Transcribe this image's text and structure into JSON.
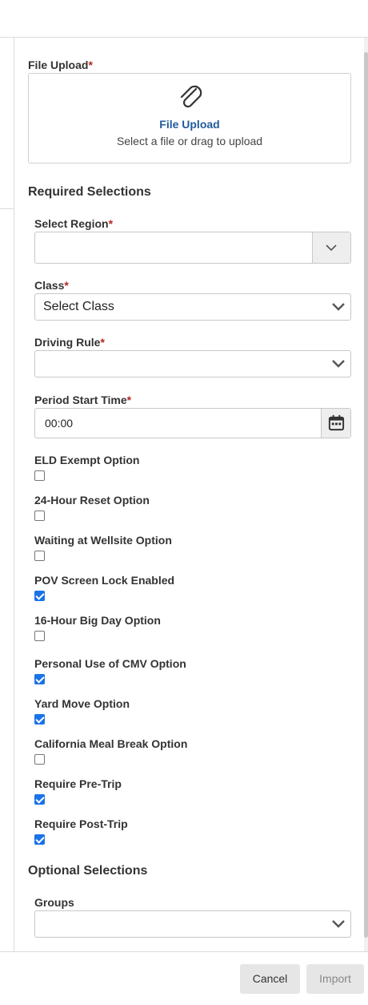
{
  "file_upload": {
    "label": "File Upload",
    "required_mark": "*",
    "link_text": "File Upload",
    "hint": "Select a file or drag to upload"
  },
  "required_section": {
    "title": "Required Selections",
    "select_region": {
      "label": "Select Region",
      "required_mark": "*",
      "value": ""
    },
    "class": {
      "label": "Class",
      "required_mark": "*",
      "value": "Select Class"
    },
    "driving_rule": {
      "label": "Driving Rule",
      "required_mark": "*",
      "value": ""
    },
    "period_start_time": {
      "label": "Period Start Time",
      "required_mark": "*",
      "value": "00:00"
    },
    "options": [
      {
        "label": "ELD Exempt Option",
        "checked": false
      },
      {
        "label": "24-Hour Reset Option",
        "checked": false
      },
      {
        "label": "Waiting at Wellsite Option",
        "checked": false
      },
      {
        "label": "POV Screen Lock Enabled",
        "checked": true
      },
      {
        "label": "16-Hour Big Day Option",
        "checked": false
      },
      {
        "label": "Personal Use of CMV Option",
        "checked": true
      },
      {
        "label": "Yard Move Option",
        "checked": true
      },
      {
        "label": "California Meal Break Option",
        "checked": false
      },
      {
        "label": "Require Pre-Trip",
        "checked": true
      },
      {
        "label": "Require Post-Trip",
        "checked": true
      }
    ]
  },
  "optional_section": {
    "title": "Optional Selections",
    "groups": {
      "label": "Groups",
      "value": ""
    }
  },
  "footer": {
    "cancel_label": "Cancel",
    "import_label": "Import"
  },
  "colors": {
    "link": "#1f5a9b",
    "required": "#b3261e",
    "checkbox": "#1a73e8"
  },
  "icons": {
    "upload": "paperclip-icon",
    "dropdown": "chevron-down-icon",
    "time": "calendar-icon"
  }
}
